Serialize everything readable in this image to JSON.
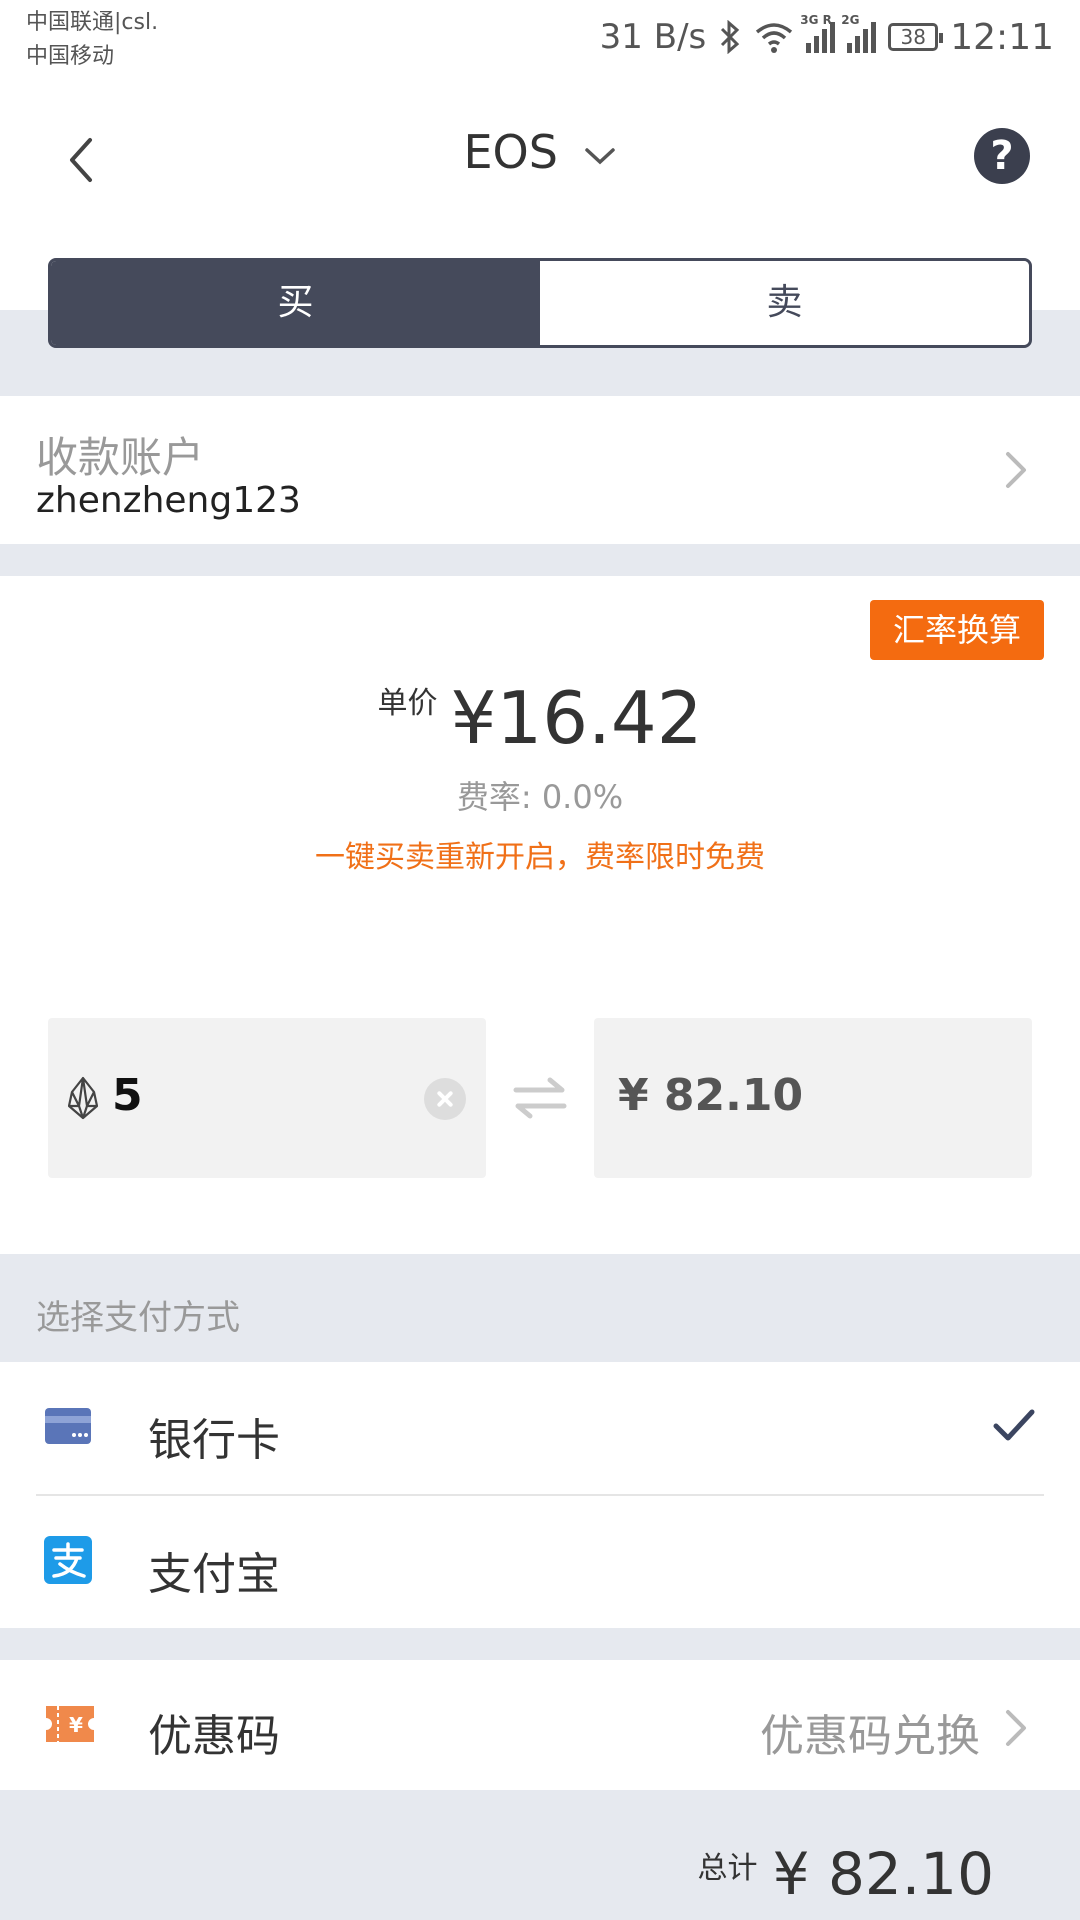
{
  "status_bar": {
    "carrier_1": "中国联通|csl.",
    "carrier_2": "中国移动",
    "net_speed": "31 B/s",
    "sig1_tag": "3G R",
    "sig2_tag": "2G",
    "battery": "38",
    "time": "12:11"
  },
  "header": {
    "title": "EOS",
    "help": "?",
    "buy_label": "买",
    "sell_label": "卖",
    "active_tab": "买"
  },
  "account": {
    "label": "收款账户",
    "value": "zhenzheng123"
  },
  "price": {
    "rate_button": "汇率换算",
    "unit_label": "单价",
    "unit_value": "¥16.42",
    "fee_text": "费率: 0.0%",
    "promo_text": "一键买卖重新开启，费率限时免费",
    "eos_amount": "5",
    "cny_amount": "¥ 82.10"
  },
  "payment": {
    "heading": "选择支付方式",
    "methods": [
      {
        "label": "银行卡",
        "icon": "bank-card-icon",
        "selected": true
      },
      {
        "label": "支付宝",
        "icon": "alipay-icon",
        "selected": false
      }
    ]
  },
  "coupon": {
    "label": "优惠码",
    "action": "优惠码兑换"
  },
  "total": {
    "label": "总计",
    "value": "¥ 82.10"
  },
  "colors": {
    "accent_dark": "#454a5b",
    "orange": "#f46b10",
    "bank_blue": "#5a75b8",
    "alipay_blue": "#1e9be8"
  }
}
